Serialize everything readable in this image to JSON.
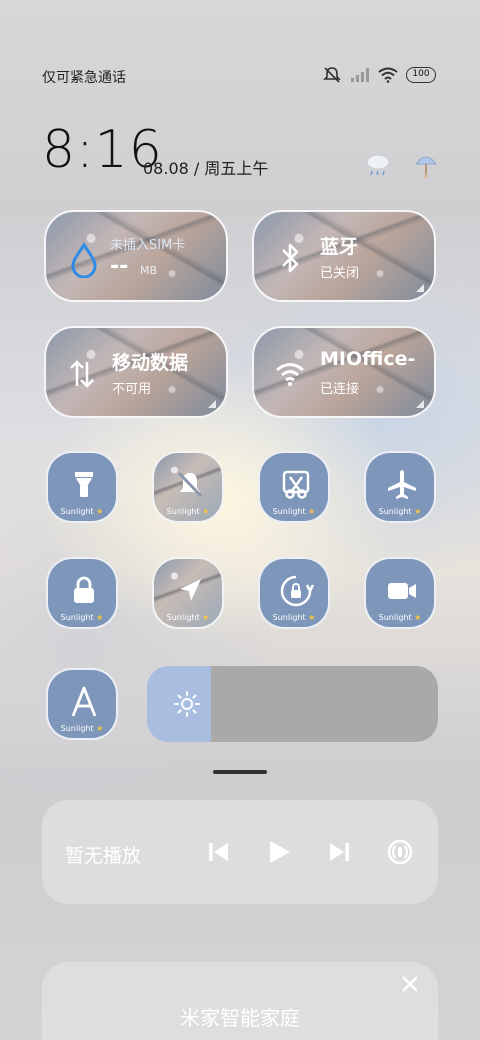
{
  "status_bar": {
    "carrier_text": "仅可紧急通话",
    "battery_level": "100",
    "icons": [
      "mute-icon",
      "signal-icon",
      "wifi-icon",
      "battery-icon"
    ]
  },
  "clock": {
    "time": "8:16",
    "date": "08.08 / 周五上午",
    "weather_icons": [
      "rain-cloud-icon",
      "umbrella-weather-icon"
    ]
  },
  "tiles": {
    "data_usage": {
      "title": "未插入SIM卡",
      "value": "--",
      "unit": "MB",
      "icon": "drop-icon"
    },
    "bluetooth": {
      "title": "蓝牙",
      "status": "已关闭",
      "icon": "bluetooth-icon"
    },
    "mobile_data": {
      "title": "移动数据",
      "status": "不可用",
      "icon": "mobile-data-icon"
    },
    "wifi": {
      "title": "MIOffice-",
      "status": "已连接",
      "icon": "wifi-icon"
    }
  },
  "toggles": [
    {
      "name": "flashlight",
      "label": "Sunlight",
      "icon": "flashlight-icon",
      "photo": false
    },
    {
      "name": "silent",
      "label": "Sunlight",
      "icon": "bell-off-icon",
      "photo": true
    },
    {
      "name": "screenshot",
      "label": "Sunlight",
      "icon": "scissors-icon",
      "photo": false
    },
    {
      "name": "airplane",
      "label": "Sunlight",
      "icon": "airplane-icon",
      "photo": false
    },
    {
      "name": "lock",
      "label": "Sunlight",
      "icon": "lock-icon",
      "photo": false
    },
    {
      "name": "location",
      "label": "Sunlight",
      "icon": "location-arrow-icon",
      "photo": true
    },
    {
      "name": "rotation-lock",
      "label": "Sunlight",
      "icon": "rotation-lock-icon",
      "photo": false
    },
    {
      "name": "screen-record",
      "label": "Sunlight",
      "icon": "video-camera-icon",
      "photo": false
    },
    {
      "name": "font",
      "label": "Sunlight",
      "icon": "font-a-icon",
      "photo": false
    }
  ],
  "brightness": {
    "level": 0.22,
    "icon": "sun-icon"
  },
  "media": {
    "title": "暂无播放",
    "controls": [
      "previous-icon",
      "play-icon",
      "next-icon",
      "cast-icon"
    ]
  },
  "smart_home": {
    "title": "米家智能家庭",
    "close_icon": "close-icon"
  },
  "colors": {
    "toggle_blue": "#7d96b9",
    "slider_fill": "#a9bde0",
    "slider_track": "#a9a9aa",
    "drop_blue": "#2f8be6"
  }
}
